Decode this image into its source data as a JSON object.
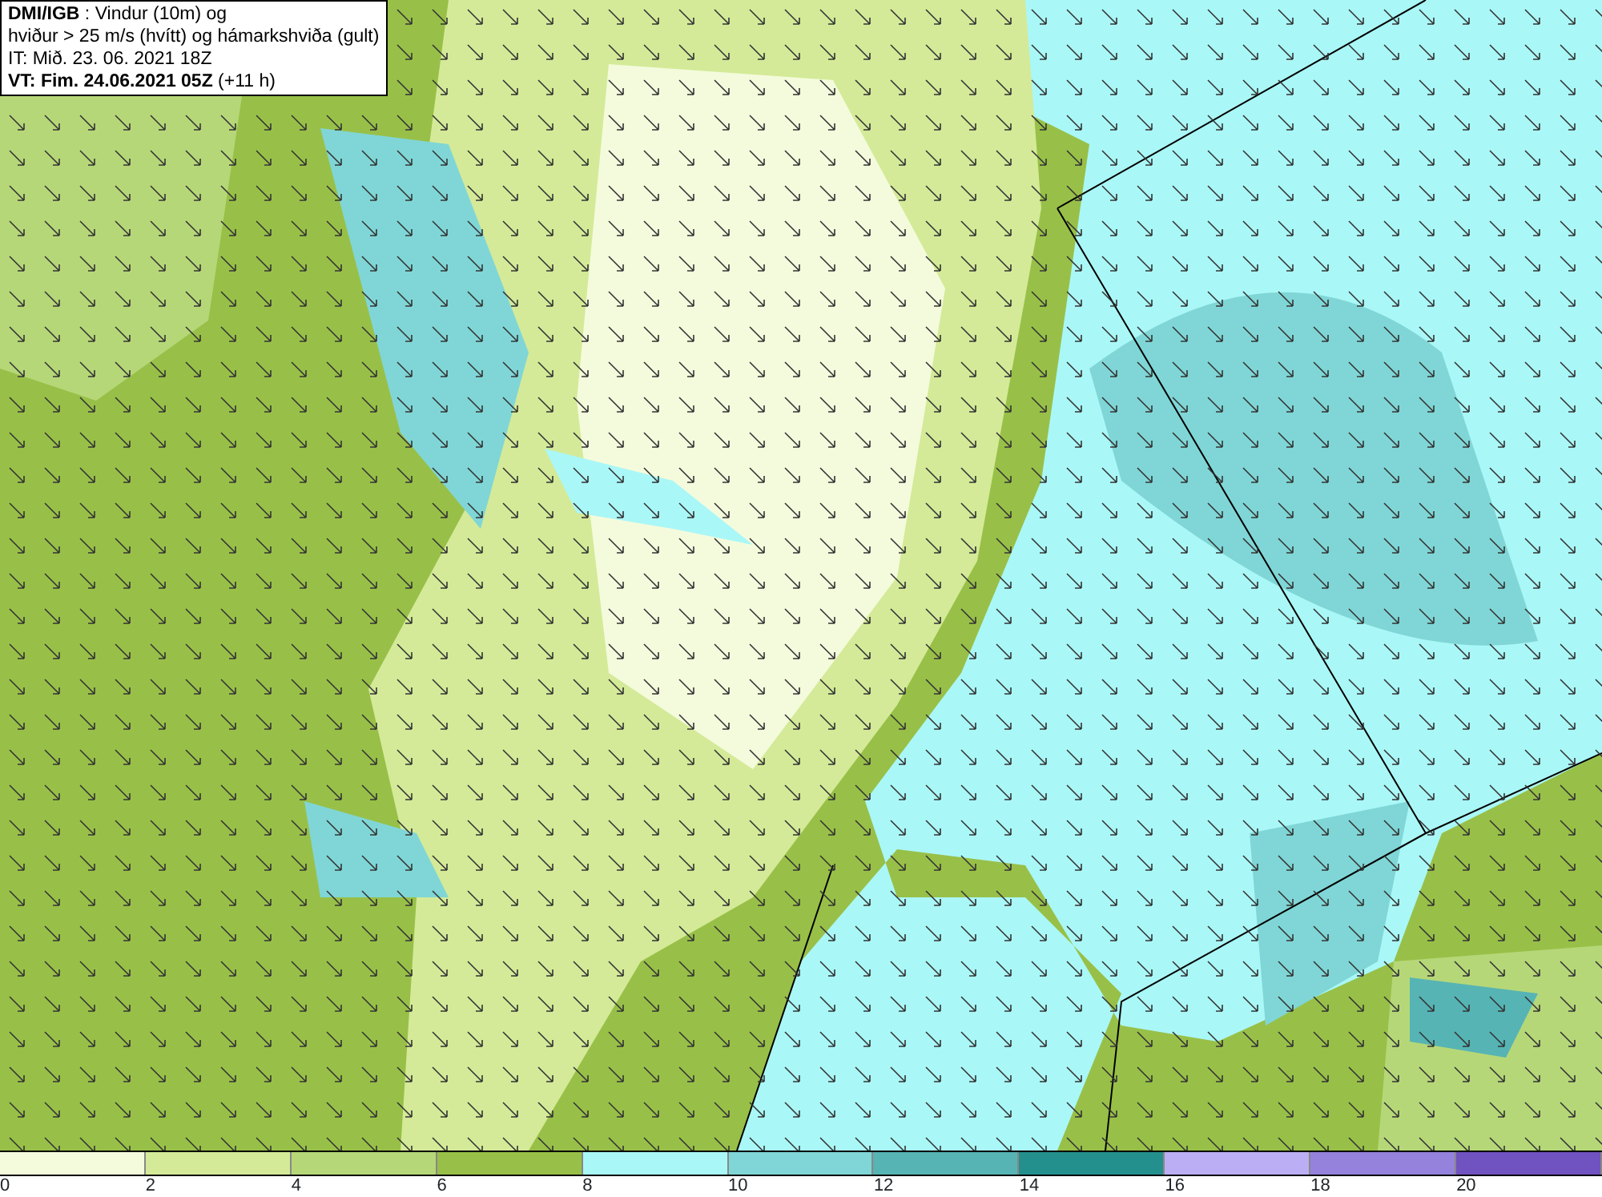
{
  "info_box": {
    "lines": [
      "**DMI/IGB** : Vindur (10m) og",
      "hviður > 25 m/s (hvítt) og hámarkshviða (gult)",
      "IT: Mið. 23. 06. 2021 18Z",
      "**VT: Fim. 24.06.2021 05Z** (+11 h)"
    ]
  },
  "legend": {
    "bins": [
      {
        "label": "0",
        "color": "#f4fbdc"
      },
      {
        "label": "2",
        "color": "#d4ea98"
      },
      {
        "label": "4",
        "color": "#b6d778"
      },
      {
        "label": "6",
        "color": "#98c048"
      },
      {
        "label": "8",
        "color": "#aaf7f7"
      },
      {
        "label": "10",
        "color": "#80d6d6"
      },
      {
        "label": "12",
        "color": "#56b4b4"
      },
      {
        "label": "14",
        "color": "#24908e"
      },
      {
        "label": "16",
        "color": "#bcaef4"
      },
      {
        "label": "18",
        "color": "#9482dc"
      },
      {
        "label": "20",
        "color": "#7052c0"
      }
    ]
  }
}
